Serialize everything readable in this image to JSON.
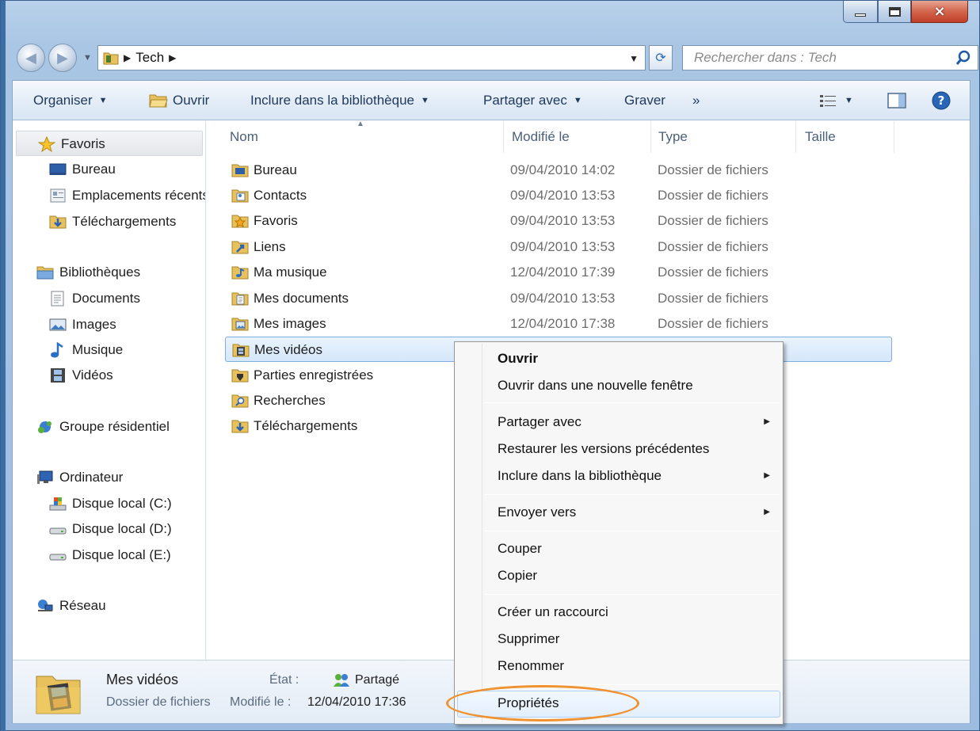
{
  "window": {
    "caption_close": "×"
  },
  "address": {
    "breadcrumb": "Tech",
    "search_placeholder": "Rechercher dans : Tech"
  },
  "toolbar": {
    "organize": "Organiser",
    "open": "Ouvrir",
    "include": "Inclure dans la bibliothèque",
    "share": "Partager avec",
    "burn": "Graver",
    "more": "»"
  },
  "nav": {
    "favorites": "Favoris",
    "fav_items": [
      "Bureau",
      "Emplacements récents",
      "Téléchargements"
    ],
    "libraries": "Bibliothèques",
    "lib_items": [
      "Documents",
      "Images",
      "Musique",
      "Vidéos"
    ],
    "homegroup": "Groupe résidentiel",
    "computer": "Ordinateur",
    "drives": [
      "Disque local (C:)",
      "Disque local (D:)",
      "Disque local (E:)"
    ],
    "network": "Réseau"
  },
  "columns": {
    "name": "Nom",
    "modified": "Modifié le",
    "type": "Type",
    "size": "Taille"
  },
  "files": [
    {
      "name": "Bureau",
      "date": "09/04/2010 14:02",
      "type": "Dossier de fichiers"
    },
    {
      "name": "Contacts",
      "date": "09/04/2010 13:53",
      "type": "Dossier de fichiers"
    },
    {
      "name": "Favoris",
      "date": "09/04/2010 13:53",
      "type": "Dossier de fichiers"
    },
    {
      "name": "Liens",
      "date": "09/04/2010 13:53",
      "type": "Dossier de fichiers"
    },
    {
      "name": "Ma musique",
      "date": "12/04/2010 17:39",
      "type": "Dossier de fichiers"
    },
    {
      "name": "Mes documents",
      "date": "09/04/2010 13:53",
      "type": "Dossier de fichiers"
    },
    {
      "name": "Mes images",
      "date": "12/04/2010 17:38",
      "type": "Dossier de fichiers"
    },
    {
      "name": "Mes vidéos",
      "date": "",
      "type": ""
    },
    {
      "name": "Parties enregistrées",
      "date": "",
      "type": ""
    },
    {
      "name": "Recherches",
      "date": "",
      "type": ""
    },
    {
      "name": "Téléchargements",
      "date": "",
      "type": ""
    }
  ],
  "details": {
    "name": "Mes vidéos",
    "type": "Dossier de fichiers",
    "state_label": "État :",
    "state_value": "Partagé",
    "modified_label": "Modifié le :",
    "modified_value": "12/04/2010 17:36"
  },
  "context_menu": {
    "open": "Ouvrir",
    "open_new_window": "Ouvrir dans une nouvelle fenêtre",
    "share_with": "Partager avec",
    "restore": "Restaurer les versions précédentes",
    "include": "Inclure dans la bibliothèque",
    "send_to": "Envoyer vers",
    "cut": "Couper",
    "copy": "Copier",
    "create_shortcut": "Créer un raccourci",
    "delete": "Supprimer",
    "rename": "Renommer",
    "properties": "Propriétés"
  },
  "colors": {
    "highlight_ring": "#f0922f",
    "selection": "#d5e7fa",
    "toolbar_text": "#1e395b"
  }
}
